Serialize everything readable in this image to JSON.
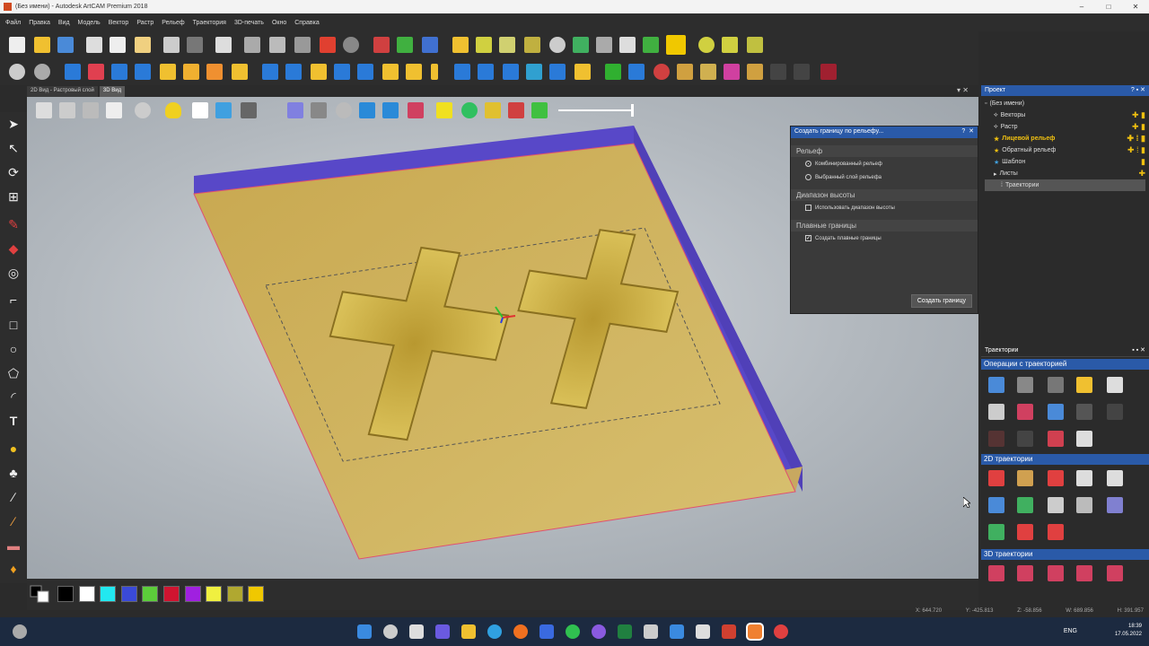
{
  "window": {
    "icon": "artcam-icon",
    "title_text": "(Без имени) - Autodesk ArtCAM Premium 2018",
    "buttons": [
      "–",
      "□",
      "✕"
    ]
  },
  "menu": [
    "Файл",
    "Правка",
    "Вид",
    "Модель",
    "Вектор",
    "Растр",
    "Рельеф",
    "Траектория",
    "3D-печать",
    "Окно",
    "Справка"
  ],
  "view_tabs": [
    "2D Вид - Растровый слой",
    "3D Вид"
  ],
  "relief_panel": {
    "title": "Создать границу по рельефу...",
    "sections": {
      "relief": "Рельеф",
      "height_range": "Диапазон высоты",
      "smooth": "Плавные границы"
    },
    "options": {
      "combined": "Комбинированный рельеф",
      "selected_layer": "Выбранный слой рельефа",
      "use_height_range": "Использовать диапазон высоты",
      "create_smooth": "Создать плавные границы"
    },
    "button": "Создать границу"
  },
  "project": {
    "title": "Проект",
    "tree": [
      "(Без имени)",
      "Векторы",
      "Растр",
      "Лицевой рельеф",
      "Обратный рельеф",
      "Шаблон",
      "Листы",
      "Траектории"
    ]
  },
  "toolpaths": {
    "title": "Траектории",
    "sec_ops": "Операции с траекторией",
    "sec_2d": "2D траектории",
    "sec_3d": "3D траектории"
  },
  "coords": {
    "x": "X: 644.720",
    "y": "Y: -425.813",
    "z": "Z: -58.856",
    "w": "W: 689.856",
    "h": "H: 391.957"
  },
  "tray": {
    "lang": "ENG",
    "time": "18:39",
    "date": "17.05.2022"
  },
  "palette_colors": [
    "#000000",
    "#ffffff",
    "#22e8f0",
    "#3a4ad8",
    "#5ccd3a",
    "#d01430",
    "#a020e0",
    "#f0f040",
    "#b0a830",
    "#f0c800"
  ],
  "accent": "#2a5aa8"
}
